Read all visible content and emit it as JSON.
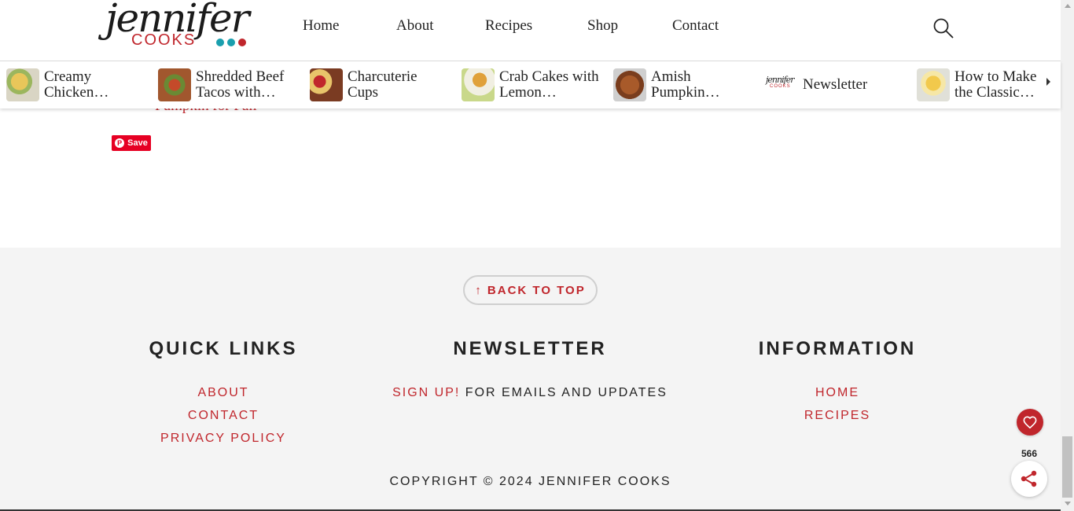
{
  "logo": {
    "script": "jennifer",
    "cooks": "COOKS",
    "dot_colors": [
      "#1a9fae",
      "#1a9fae",
      "#c0262c"
    ]
  },
  "nav": {
    "items": [
      "Home",
      "About",
      "Recipes",
      "Shop",
      "Contact"
    ]
  },
  "search": {
    "icon": "search-icon"
  },
  "carousel": {
    "items": [
      {
        "label": "Creamy Chicken…"
      },
      {
        "label": "Shredded Beef Tacos with…"
      },
      {
        "label": "Charcuterie Cups"
      },
      {
        "label": "Crab Cakes with Lemon…"
      },
      {
        "label": "Amish Pumpkin…"
      },
      {
        "label": "Newsletter"
      },
      {
        "label": "How to Make the Classic…"
      }
    ],
    "next_icon": "chevron-right-icon"
  },
  "body": {
    "partial_link": "Pumpkin for Fall",
    "pin_save": "Save"
  },
  "footer": {
    "back_to_top": "↑ BACK TO TOP",
    "quick_links": {
      "title": "QUICK LINKS",
      "items": [
        "ABOUT",
        "CONTACT",
        "PRIVACY POLICY"
      ]
    },
    "newsletter": {
      "title": "NEWSLETTER",
      "link": "SIGN UP!",
      "text": " FOR EMAILS AND UPDATES"
    },
    "information": {
      "title": "INFORMATION",
      "items": [
        "HOME",
        "RECIPES"
      ]
    },
    "copyright": "COPYRIGHT © 2024 JENNIFER COOKS"
  },
  "floating": {
    "favorite_icon": "heart-icon",
    "share_count": "566",
    "share_icon": "share-icon"
  },
  "colors": {
    "accent": "#c0262c",
    "footer_bg": "#f4f4f4",
    "pinterest": "#e60023"
  }
}
